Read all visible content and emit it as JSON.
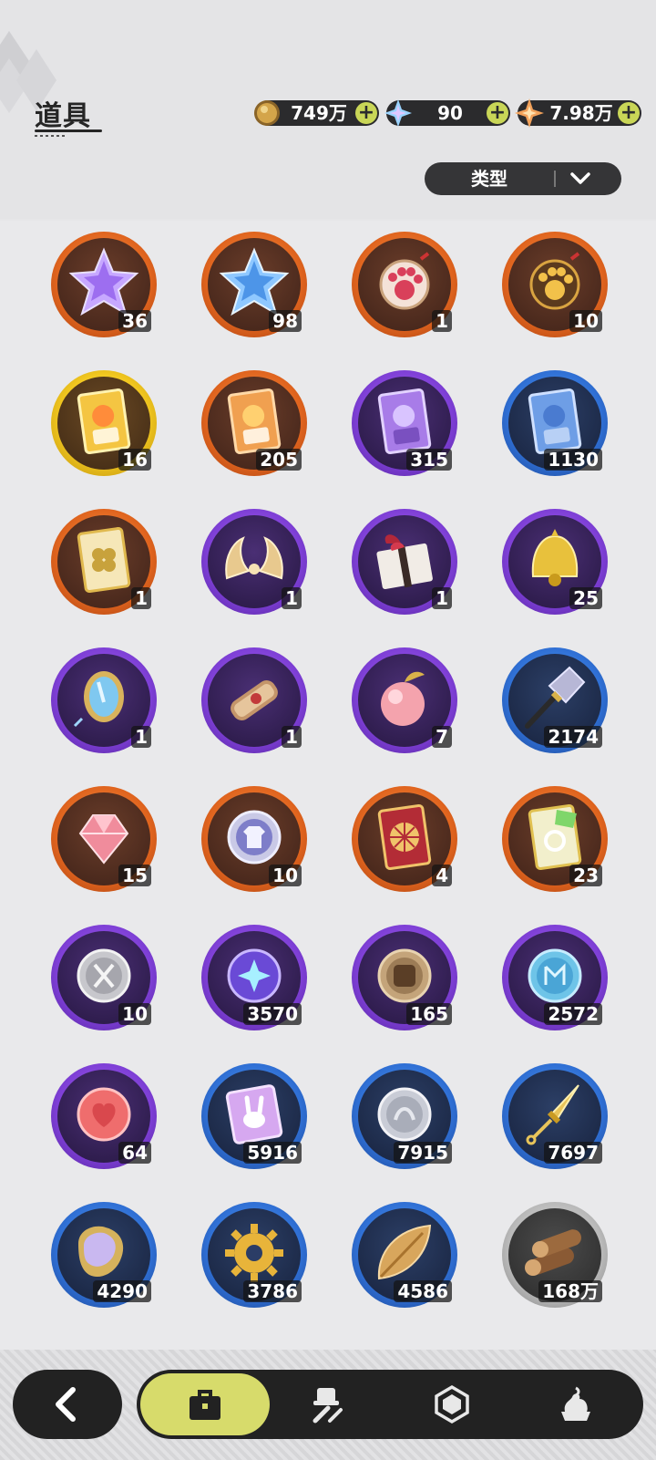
{
  "header": {
    "title": "道具",
    "currencies": [
      {
        "name": "gold-coin",
        "value": "749万",
        "color": "#d4a54a"
      },
      {
        "name": "crystal",
        "value": "90",
        "color": "#9ad3ff"
      },
      {
        "name": "star-gem",
        "value": "7.98万",
        "color": "#f2a15a"
      }
    ],
    "type_filter": "类型"
  },
  "items": [
    {
      "icon": "purple-crystal-star-icon",
      "count": "36",
      "rarity": "orange"
    },
    {
      "icon": "blue-crystal-star-icon",
      "count": "98",
      "rarity": "orange"
    },
    {
      "icon": "red-paw-charm-icon",
      "count": "1",
      "rarity": "orange"
    },
    {
      "icon": "gold-paw-charm-icon",
      "count": "10",
      "rarity": "orange"
    },
    {
      "icon": "gold-character-card-icon",
      "count": "16",
      "rarity": "gold"
    },
    {
      "icon": "orange-character-card-icon",
      "count": "205",
      "rarity": "orange"
    },
    {
      "icon": "purple-character-card-icon",
      "count": "315",
      "rarity": "purple"
    },
    {
      "icon": "blue-character-card-icon",
      "count": "1130",
      "rarity": "blue"
    },
    {
      "icon": "clover-ticket-icon",
      "count": "1",
      "rarity": "orange"
    },
    {
      "icon": "golden-horns-icon",
      "count": "1",
      "rarity": "purple"
    },
    {
      "icon": "gift-box-icon",
      "count": "1",
      "rarity": "purple"
    },
    {
      "icon": "golden-bell-icon",
      "count": "25",
      "rarity": "purple"
    },
    {
      "icon": "magic-mirror-icon",
      "count": "1",
      "rarity": "purple"
    },
    {
      "icon": "scroll-icon",
      "count": "1",
      "rarity": "purple"
    },
    {
      "icon": "peach-icon",
      "count": "7",
      "rarity": "purple"
    },
    {
      "icon": "shovel-icon",
      "count": "2174",
      "rarity": "blue"
    },
    {
      "icon": "ruby-gem-icon",
      "count": "15",
      "rarity": "orange"
    },
    {
      "icon": "outfit-token-icon",
      "count": "10",
      "rarity": "orange"
    },
    {
      "icon": "wheel-ticket-icon",
      "count": "4",
      "rarity": "orange"
    },
    {
      "icon": "rainbow-ticket-icon",
      "count": "23",
      "rarity": "orange"
    },
    {
      "icon": "scissors-coin-icon",
      "count": "10",
      "rarity": "purple"
    },
    {
      "icon": "star-orb-icon",
      "count": "3570",
      "rarity": "purple"
    },
    {
      "icon": "fist-coin-icon",
      "count": "165",
      "rarity": "purple"
    },
    {
      "icon": "rune-coin-icon",
      "count": "2572",
      "rarity": "purple"
    },
    {
      "icon": "heart-coin-icon",
      "count": "64",
      "rarity": "purple"
    },
    {
      "icon": "bunny-card-icon",
      "count": "5916",
      "rarity": "blue"
    },
    {
      "icon": "silver-coin-icon",
      "count": "7915",
      "rarity": "blue"
    },
    {
      "icon": "golden-dagger-icon",
      "count": "7697",
      "rarity": "blue"
    },
    {
      "icon": "scale-badge-icon",
      "count": "4290",
      "rarity": "blue"
    },
    {
      "icon": "gear-icon",
      "count": "3786",
      "rarity": "blue"
    },
    {
      "icon": "leaf-icon",
      "count": "4586",
      "rarity": "blue"
    },
    {
      "icon": "wood-logs-icon",
      "count": "168万",
      "rarity": "gray"
    }
  ],
  "nav": {
    "back": "back-arrow-icon",
    "tabs": [
      {
        "icon": "bag-icon",
        "active": true
      },
      {
        "icon": "hat-tools-icon",
        "active": false
      },
      {
        "icon": "hexagon-gem-icon",
        "active": false
      },
      {
        "icon": "dessert-icon",
        "active": false
      }
    ]
  }
}
